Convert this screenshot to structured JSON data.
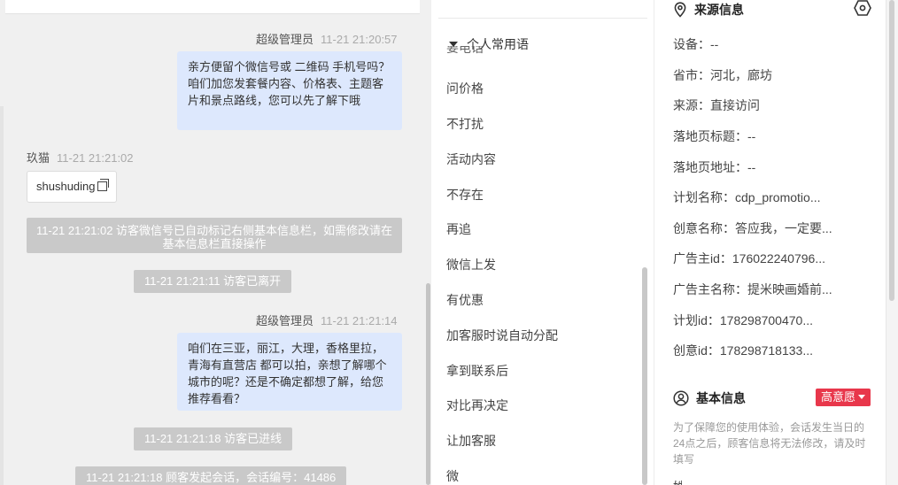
{
  "chat": {
    "messages": [
      {
        "agent_name": "超级管理员",
        "agent_time": "11-21 21:20:57",
        "text": "亲方便留个微信号或 二维码 手机号吗？咱们加您发套餐内容、价格表、主题客片和景点路线，您可以先了解下哦"
      },
      {
        "visitor_name": "玖猫",
        "visitor_time": "11-21 21:21:02",
        "text": "shushuding"
      },
      {
        "system": "11-21 21:21:02 访客微信号已自动标记右侧基本信息栏，如需修改请在基本信息栏直接操作"
      },
      {
        "system": "11-21 21:21:11 访客已离开"
      },
      {
        "agent_name": "超级管理员",
        "agent_time": "11-21 21:21:14",
        "text": "咱们在三亚，丽江，大理，香格里拉，青海有直营店 都可以拍，亲想了解哪个城市的呢？还是不确定都想了解，给您推荐看看？"
      },
      {
        "system": "11-21 21:21:18 访客已进线"
      },
      {
        "system": "11-21 21:21:18 顾客发起会话，会话编号：41486"
      }
    ]
  },
  "phrases": {
    "header": "个人常用语",
    "clipped_item": "要电话",
    "items": [
      "问价格",
      "不打扰",
      "活动内容",
      "不存在",
      "再追",
      "微信上发",
      "有优惠",
      "加客服时说自动分配",
      "拿到联系后",
      "对比再决定",
      "让加客服",
      "微"
    ]
  },
  "source_info": {
    "title": "来源信息",
    "rows": [
      "设备：--",
      "省市：河北，廊坊",
      "来源：直接访问",
      "落地页标题：--",
      "落地页地址：--",
      "计划名称：cdp_promotio...",
      "创意名称：答应我，一定要...",
      "广告主id：176022240796...",
      "广告主名称：提米映画婚前...",
      "计划id：178298700470...",
      "创意id：178298718133..."
    ]
  },
  "basic_info": {
    "title": "基本信息",
    "intent_badge": "高意愿",
    "note": "为了保障您的使用体验，会话发生当日的24点之后，顾客信息将无法修改，请及时填写",
    "cut_label": "姓"
  },
  "colors": {
    "agent_bubble": "#dde8fd",
    "system_pill": "#c9c9c9",
    "badge": "#e8374b"
  }
}
